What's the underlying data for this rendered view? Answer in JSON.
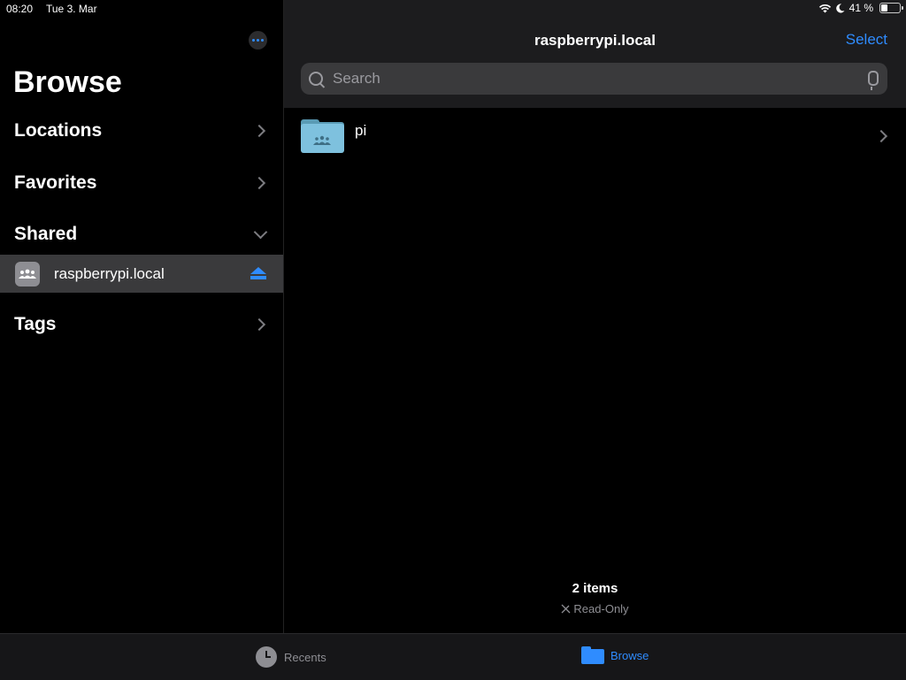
{
  "status_bar": {
    "time": "08:20",
    "date": "Tue 3. Mar",
    "battery": "41 %",
    "battery_level": 0.41
  },
  "sidebar": {
    "title": "Browse",
    "sections": {
      "locations": "Locations",
      "favorites": "Favorites",
      "shared": "Shared",
      "tags": "Tags"
    },
    "shared_items": [
      {
        "label": "raspberrypi.local"
      }
    ]
  },
  "main": {
    "title": "raspberrypi.local",
    "select_label": "Select",
    "search": {
      "placeholder": "Search",
      "value": ""
    },
    "files": [
      {
        "name": "pi"
      }
    ],
    "footer": {
      "count": "2 items",
      "status": "Read-Only"
    }
  },
  "tabbar": {
    "recents": "Recents",
    "browse": "Browse"
  },
  "colors": {
    "accent": "#2f8cff",
    "folder": "#7ec1de"
  }
}
